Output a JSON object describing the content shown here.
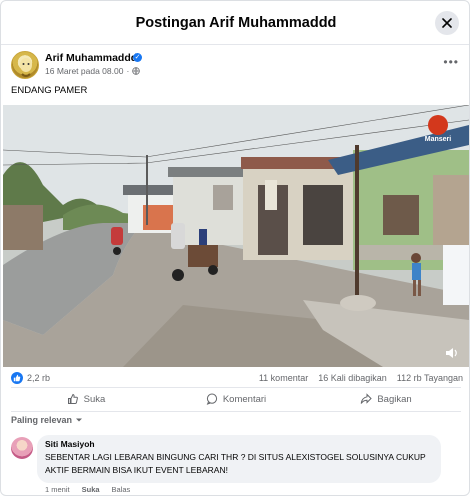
{
  "modal": {
    "title": "Postingan Arif Muhammaddd"
  },
  "post": {
    "author": "Arif Muhammaddd",
    "timestamp": "16 Maret pada 08.00",
    "audience_icon": "globe-icon",
    "text": "ENDANG PAMER",
    "photo_watermark": "Manseri"
  },
  "stats": {
    "reactions": "2,2 rb",
    "comments": "11 komentar",
    "shares": "16 Kali dibagikan",
    "views": "112 rb Tayangan"
  },
  "actions": {
    "like": "Suka",
    "comment": "Komentari",
    "share": "Bagikan"
  },
  "comments": {
    "sort_label": "Paling relevan",
    "items": [
      {
        "author": "Siti Masiyoh",
        "text": "SEBENTAR LAGI LEBARAN BINGUNG CARI THR ? DI SITUS ALEXISTOGEL SOLUSINYA CUKUP AKTIF BERMAIN BISA IKUT EVENT LEBARAN!",
        "time": "1 menit",
        "like_label": "Suka",
        "reply_label": "Balas"
      }
    ]
  },
  "colors": {
    "accent": "#1877f2",
    "secondary_text": "#65676b",
    "bubble_bg": "#f0f2f5"
  }
}
